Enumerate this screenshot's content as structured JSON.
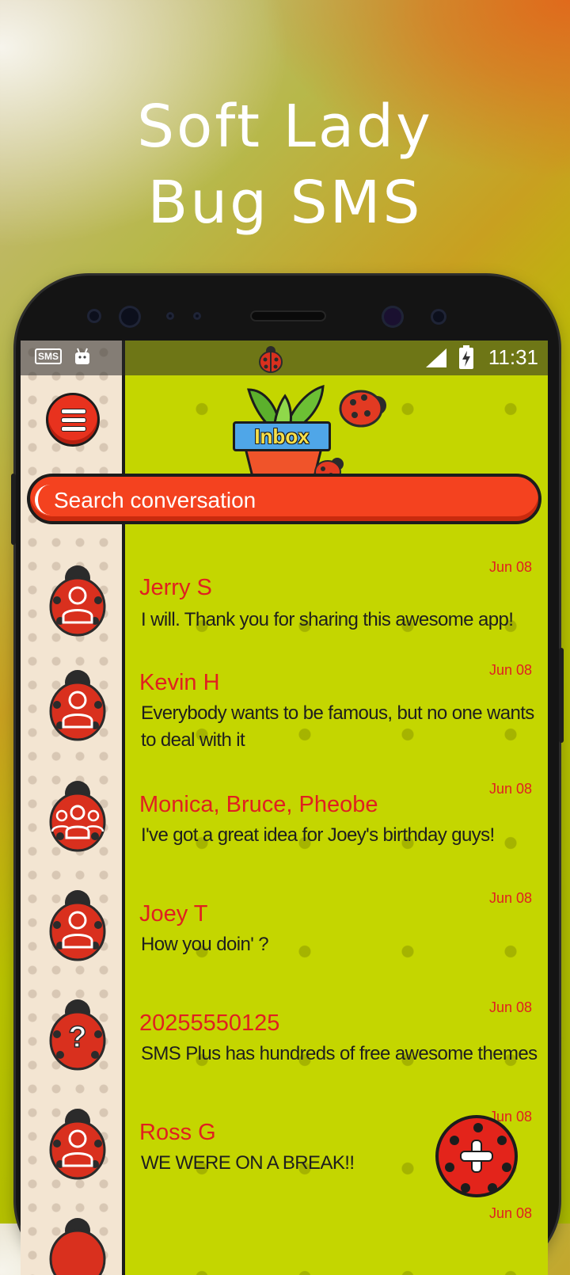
{
  "headline": {
    "line1": "Soft Lady",
    "line2": "Bug SMS"
  },
  "status_bar": {
    "sms_badge": "SMS",
    "time": "11:31"
  },
  "header": {
    "inbox_label": "Inbox"
  },
  "search": {
    "placeholder": "Search conversation"
  },
  "conversations": [
    {
      "name": "Jerry S",
      "snippet": "I will. Thank you for sharing this awesome app!",
      "date": "Jun 08",
      "avatar": "person-icon"
    },
    {
      "name": "Kevin H",
      "snippet": "Everybody wants to be famous, but no one wants to deal with it",
      "date": "Jun 08",
      "avatar": "person-icon"
    },
    {
      "name": "Monica, Bruce, Pheobe",
      "snippet": "I've got a great idea for Joey's birthday guys!",
      "date": "Jun 08",
      "avatar": "group-icon"
    },
    {
      "name": "Joey T",
      "snippet": "How you doin' ?",
      "date": "Jun 08",
      "avatar": "person-icon"
    },
    {
      "name": "20255550125",
      "snippet": "SMS Plus has hundreds of free awesome themes",
      "date": "Jun 08",
      "avatar": "unknown-icon"
    },
    {
      "name": "Ross G",
      "snippet": "WE WERE ON A BREAK!!",
      "date": "Jun 08",
      "avatar": "person-icon"
    },
    {
      "name": "",
      "snippet": "",
      "date": "Jun 08",
      "avatar": "person-icon"
    }
  ],
  "fab": {
    "icon": "plus-icon"
  },
  "colors": {
    "accent": "#e02020",
    "background": "#c4d600",
    "sidebar": "#f3e5d2",
    "search": "#f4421f"
  }
}
